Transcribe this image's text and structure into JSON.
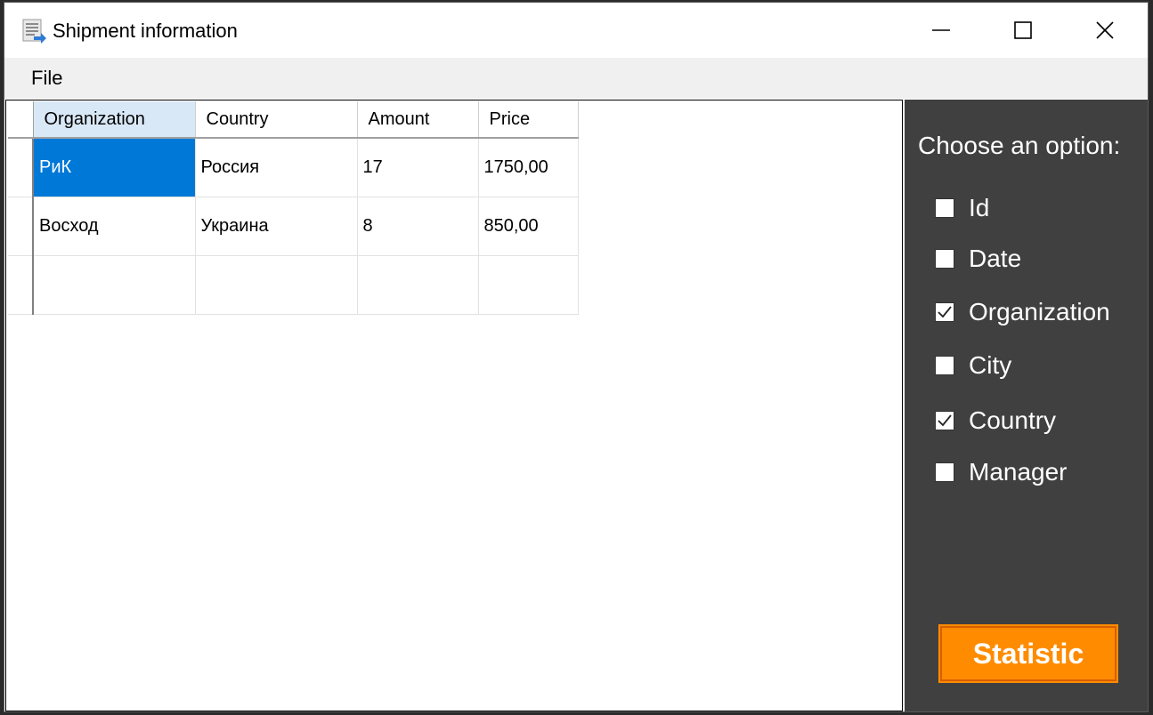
{
  "window": {
    "title": "Shipment information",
    "icons": {
      "app": "document-list-icon",
      "minimize": "minimize-icon",
      "maximize": "maximize-icon",
      "close": "close-icon"
    }
  },
  "menu": {
    "file": "File"
  },
  "grid": {
    "columns": [
      "Organization",
      "Country",
      "Amount",
      "Price"
    ],
    "rows": [
      [
        "РиК",
        "Россия",
        "17",
        "1750,00"
      ],
      [
        "Восход",
        "Украина",
        "8",
        "850,00"
      ],
      [
        "",
        "",
        "",
        ""
      ]
    ],
    "selected_cell": "РиК"
  },
  "panel": {
    "label": "Choose an option:",
    "options": [
      {
        "label": "Id",
        "checked": false
      },
      {
        "label": "Date",
        "checked": false
      },
      {
        "label": "Organization",
        "checked": true
      },
      {
        "label": "City",
        "checked": false
      },
      {
        "label": "Country",
        "checked": true
      },
      {
        "label": "Manager",
        "checked": false
      }
    ],
    "button": "Statistic"
  },
  "colors": {
    "selection": "#0078d7",
    "panel_bg": "#404040",
    "button_bg": "#ff8c00",
    "header_selected": "#d9e8f7"
  }
}
